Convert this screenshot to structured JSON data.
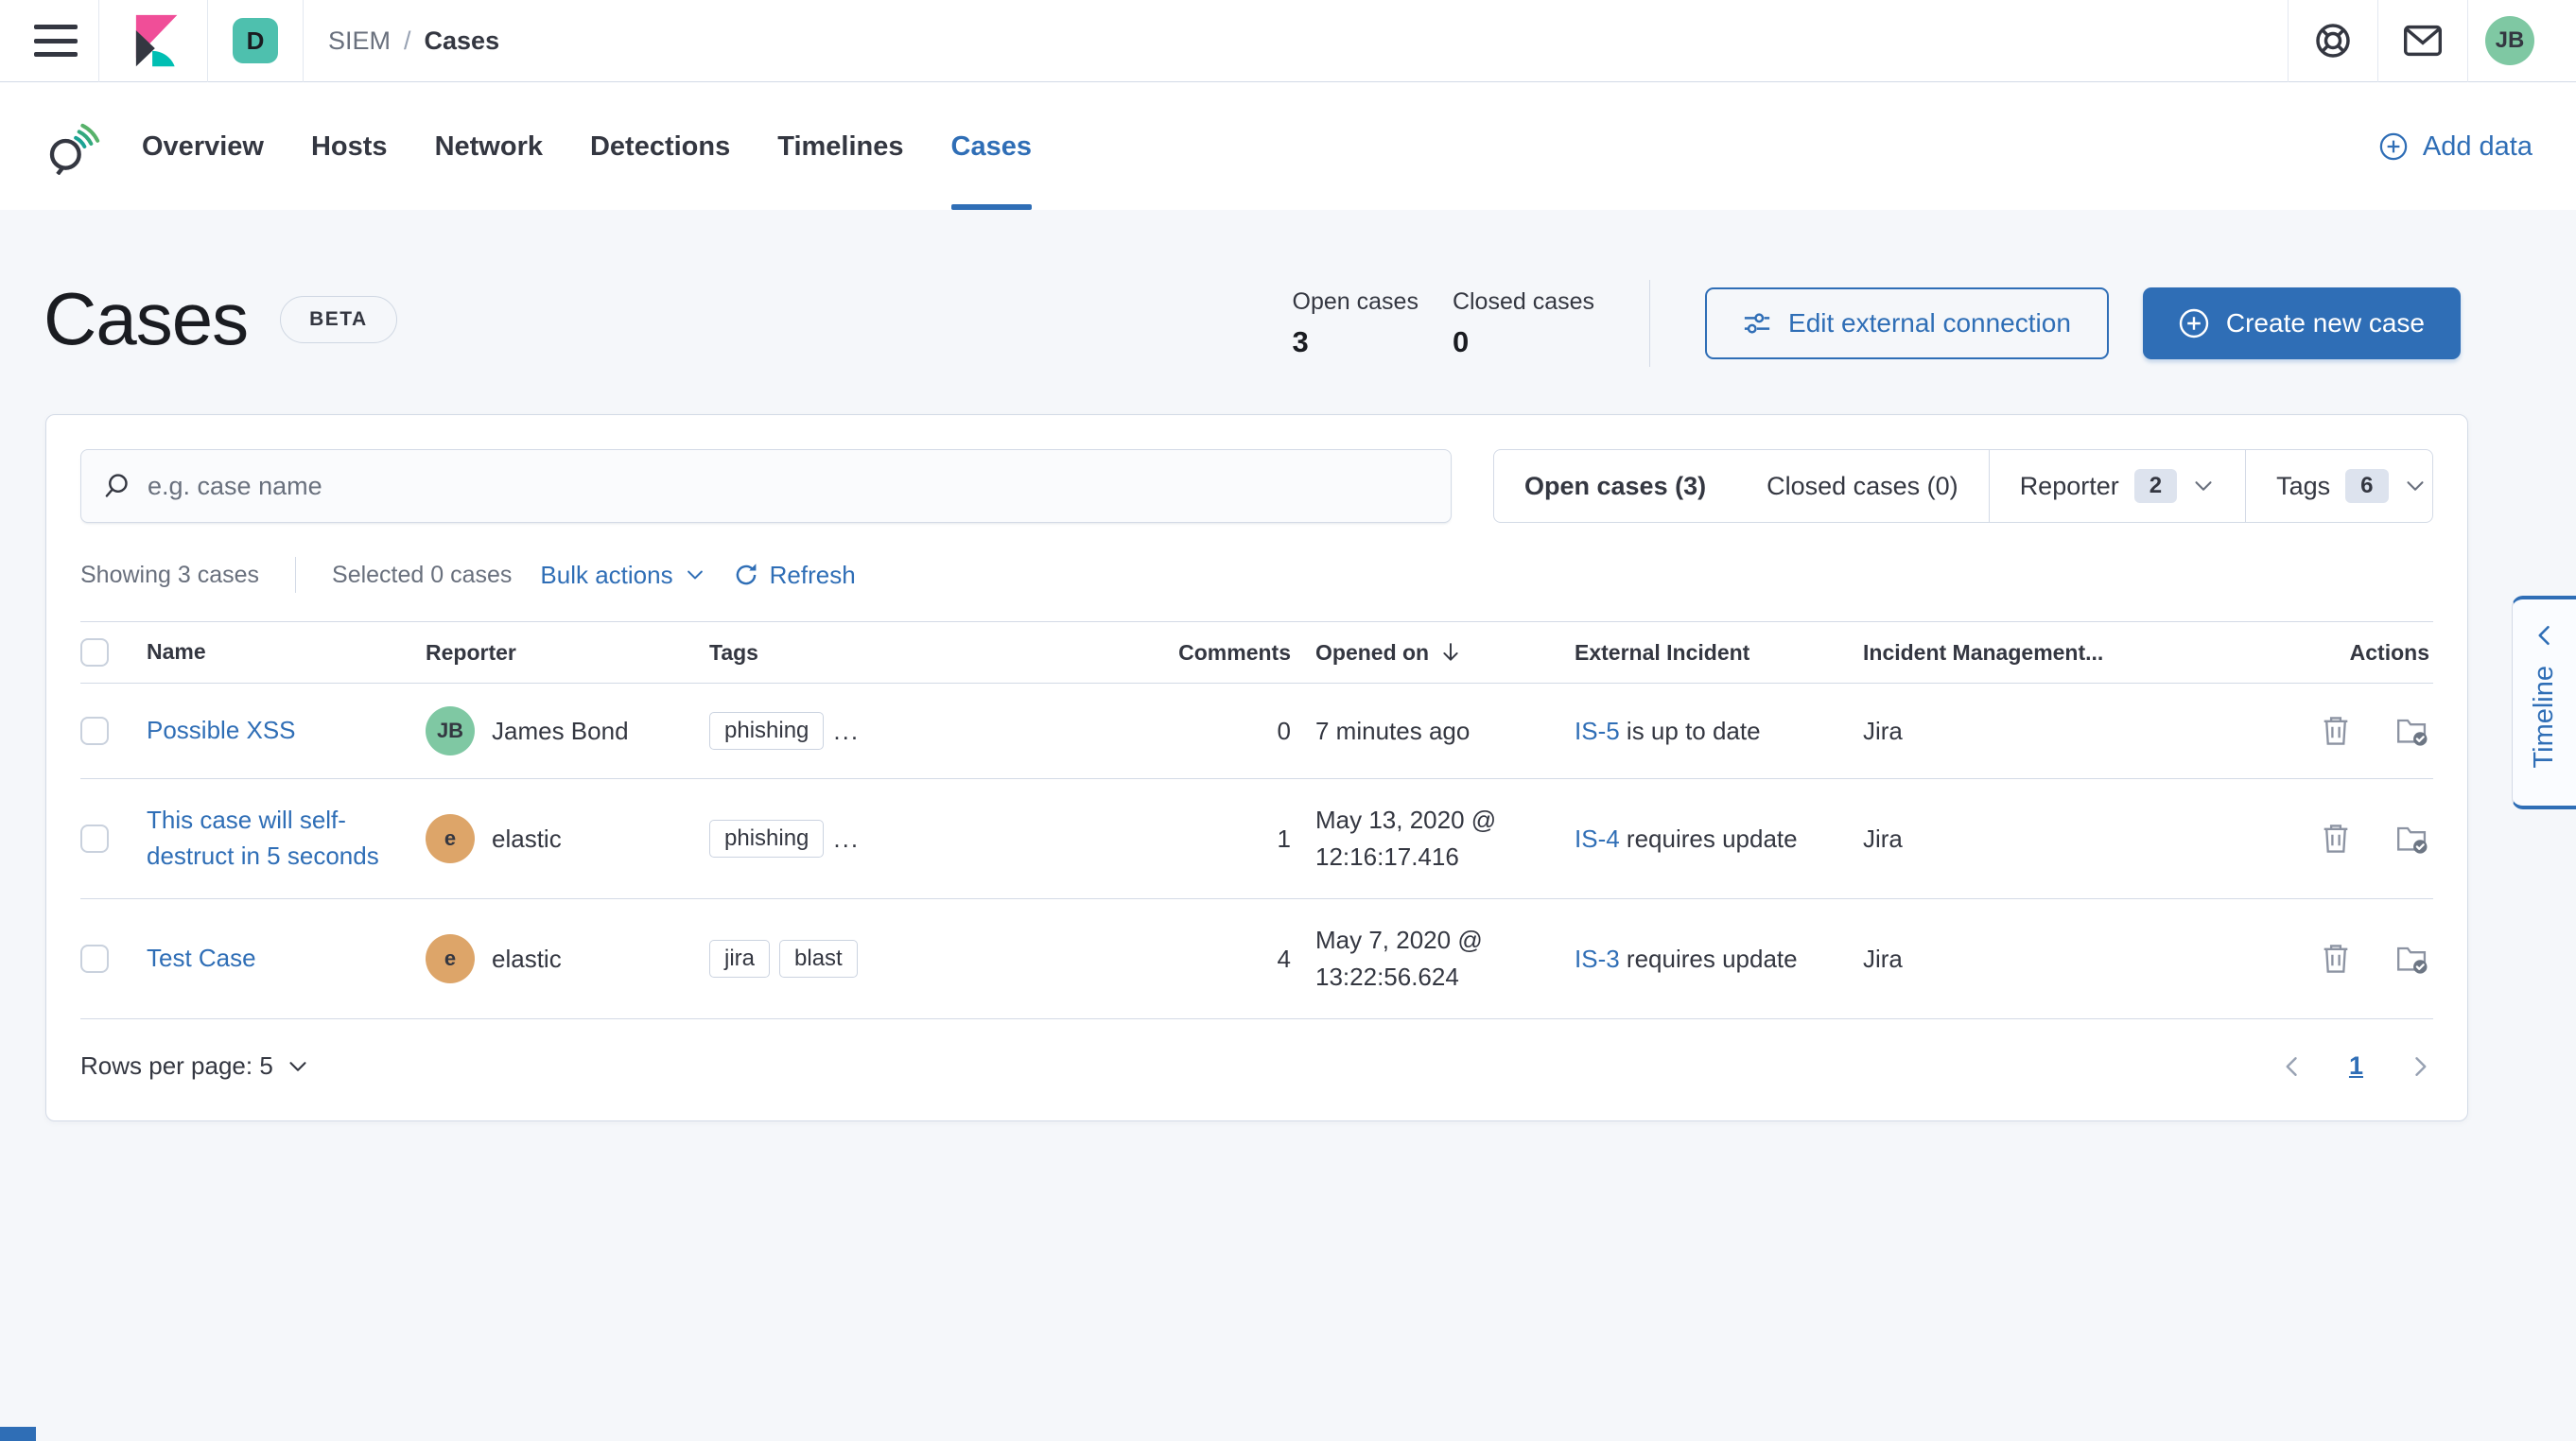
{
  "colors": {
    "primary": "#2f6eb6",
    "space_badge_bg": "#4ec0ae",
    "user_avatar_bg": "#7fc8a3",
    "avatar_james_bond": "#7fc8a3",
    "avatar_elastic": "#dda569",
    "kibana_pink": "#f04e98",
    "kibana_dark": "#343741",
    "kibana_teal": "#00bfb3",
    "action_icon_gray": "#8c93a2"
  },
  "topbar": {
    "space_initial": "D",
    "breadcrumb": {
      "app": "SIEM",
      "separator": "/",
      "page": "Cases"
    },
    "user_initials": "JB"
  },
  "nav": {
    "tabs": [
      {
        "label": "Overview"
      },
      {
        "label": "Hosts"
      },
      {
        "label": "Network"
      },
      {
        "label": "Detections"
      },
      {
        "label": "Timelines"
      },
      {
        "label": "Cases"
      }
    ],
    "active_tab": "Cases",
    "add_data_label": "Add data"
  },
  "header": {
    "title": "Cases",
    "beta_label": "BETA",
    "stats": [
      {
        "label": "Open cases",
        "value": "3"
      },
      {
        "label": "Closed cases",
        "value": "0"
      }
    ],
    "edit_button_label": "Edit external connection",
    "create_button_label": "Create new case"
  },
  "filter_bar": {
    "search_placeholder": "e.g. case name",
    "open_filter": "Open cases (3)",
    "closed_filter": "Closed cases (0)",
    "reporter_label": "Reporter",
    "reporter_count": "2",
    "tags_label": "Tags",
    "tags_count": "6"
  },
  "utility_bar": {
    "showing": "Showing 3 cases",
    "selected": "Selected 0 cases",
    "bulk_actions_label": "Bulk actions",
    "refresh_label": "Refresh"
  },
  "table": {
    "headers": {
      "name": "Name",
      "reporter": "Reporter",
      "tags": "Tags",
      "comments": "Comments",
      "opened_on": "Opened on",
      "external_incident": "External Incident",
      "incident_management": "Incident Management...",
      "actions": "Actions"
    },
    "rows": [
      {
        "name": "Possible XSS",
        "reporter": {
          "initials": "JB",
          "name": "James Bond",
          "color": "#7fc8a3"
        },
        "tags": [
          "phishing"
        ],
        "tags_overflow": "...",
        "comments": "0",
        "opened_on": "7 minutes ago",
        "external_incident": {
          "id": "IS-5",
          "status": "is up to date"
        },
        "incident_management": "Jira"
      },
      {
        "name": "This case will self-destruct in 5 seconds",
        "reporter": {
          "initials": "e",
          "name": "elastic",
          "color": "#dda569"
        },
        "tags": [
          "phishing"
        ],
        "tags_overflow": "...",
        "comments": "1",
        "opened_on": "May 13, 2020 @ 12:16:17.416",
        "external_incident": {
          "id": "IS-4",
          "status": "requires update"
        },
        "incident_management": "Jira"
      },
      {
        "name": "Test Case",
        "reporter": {
          "initials": "e",
          "name": "elastic",
          "color": "#dda569"
        },
        "tags": [
          "jira",
          "blast"
        ],
        "tags_overflow": "",
        "comments": "4",
        "opened_on": "May 7, 2020 @ 13:22:56.624",
        "external_incident": {
          "id": "IS-3",
          "status": "requires update"
        },
        "incident_management": "Jira"
      }
    ]
  },
  "footer": {
    "rows_per_page": "Rows per page: 5",
    "page": "1"
  },
  "timeline": {
    "label": "Timeline"
  }
}
